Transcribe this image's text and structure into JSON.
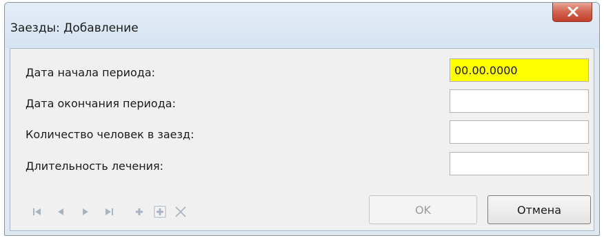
{
  "window": {
    "title": "Заезды: Добавление"
  },
  "form": {
    "fields": [
      {
        "label": "Дата начала периода:",
        "value": "00.00.0000"
      },
      {
        "label": "Дата окончания периода:",
        "value": ""
      },
      {
        "label": "Количество человек в заезд:",
        "value": ""
      },
      {
        "label": "Длительность лечения:",
        "value": ""
      }
    ]
  },
  "navigator": {
    "icons": [
      "first-record-icon",
      "prior-record-icon",
      "next-record-icon",
      "last-record-icon",
      "insert-record-icon",
      "append-record-icon",
      "delete-record-icon"
    ]
  },
  "buttons": {
    "ok": "OK",
    "cancel": "Отмена"
  },
  "colors": {
    "active_field": "#ffff00",
    "close_button": "#c94b35"
  }
}
